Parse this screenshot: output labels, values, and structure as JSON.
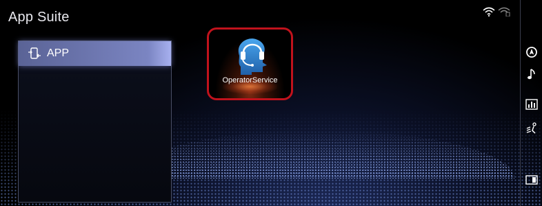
{
  "header": {
    "title": "App Suite"
  },
  "status": {
    "icons": [
      "wifi-icon",
      "signal-icon"
    ]
  },
  "sidebar": {
    "items": [
      {
        "label": "APP",
        "icon": "phone-transfer-icon",
        "selected": true
      }
    ]
  },
  "apps": [
    {
      "label": "OperatorService",
      "icon": "operator-headset-icon",
      "highlighted": true
    }
  ],
  "right_bar": {
    "buttons": [
      "navigation-icon",
      "music-note-icon",
      "equalizer-icon",
      "climate-icon",
      "screen-toggle-icon"
    ]
  },
  "colors": {
    "highlight_border": "#c1121c",
    "selected_item": "#7b85c2",
    "app_icon": "#3a8ed8"
  }
}
